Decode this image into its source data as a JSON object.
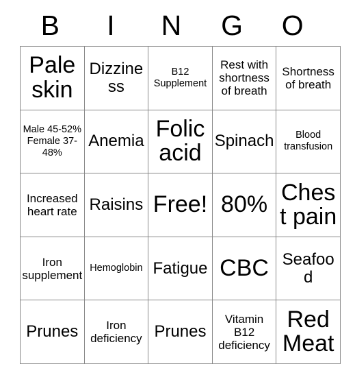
{
  "card": {
    "title": "BINGO Card",
    "header_letters": [
      "B",
      "I",
      "N",
      "G",
      "O"
    ],
    "free_space_label": "Free!",
    "colors": {
      "background": "#ffffff",
      "border": "#878787",
      "text": "#000000"
    },
    "rows": [
      [
        {
          "text": "Pale skin",
          "size": "xl"
        },
        {
          "text": "Dizziness",
          "size": "md"
        },
        {
          "text": "B12 Supplement",
          "size": "xs"
        },
        {
          "text": "Rest with shortness of breath",
          "size": "sm"
        },
        {
          "text": "Shortness of breath",
          "size": "sm"
        }
      ],
      [
        {
          "text": "Male 45-52% Female 37-48%",
          "size": "xs"
        },
        {
          "text": "Anemia",
          "size": "md"
        },
        {
          "text": "Folic acid",
          "size": "xl"
        },
        {
          "text": "Spinach",
          "size": "md"
        },
        {
          "text": "Blood transfusion",
          "size": "xs"
        }
      ],
      [
        {
          "text": "Increased heart rate",
          "size": "sm"
        },
        {
          "text": "Raisins",
          "size": "md"
        },
        {
          "text": "Free!",
          "size": "xl"
        },
        {
          "text": "80%",
          "size": "xl"
        },
        {
          "text": "Chest pain",
          "size": "xl"
        }
      ],
      [
        {
          "text": "Iron supplement",
          "size": "sm"
        },
        {
          "text": "Hemoglobin",
          "size": "xs"
        },
        {
          "text": "Fatigue",
          "size": "md"
        },
        {
          "text": "CBC",
          "size": "xl"
        },
        {
          "text": "Seafood",
          "size": "md"
        }
      ],
      [
        {
          "text": "Prunes",
          "size": "md"
        },
        {
          "text": "Iron deficiency",
          "size": "sm"
        },
        {
          "text": "Prunes",
          "size": "md"
        },
        {
          "text": "Vitamin B12 deficiency",
          "size": "sm"
        },
        {
          "text": "Red Meat",
          "size": "xl"
        }
      ]
    ]
  }
}
